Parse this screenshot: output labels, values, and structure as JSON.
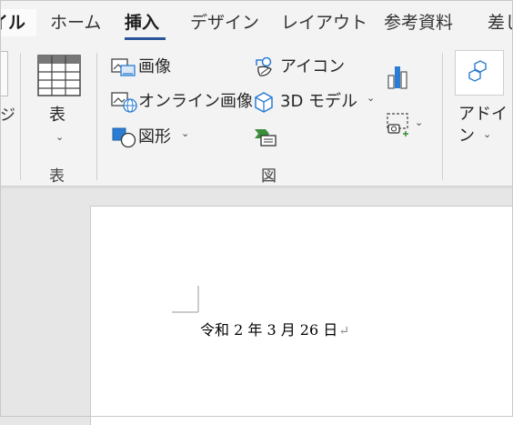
{
  "tabs": {
    "file": "イル",
    "home": "ホーム",
    "insert": "挿入",
    "design": "デザイン",
    "layout": "レイアウト",
    "references": "参考資料",
    "mailings": "差し"
  },
  "ribbon": {
    "clipped_left_text": "ジ",
    "table_group": {
      "table_button": "表",
      "label": "表"
    },
    "illustrations_group": {
      "image": "画像",
      "online_image": "オンライン画像",
      "shapes": "図形",
      "icons": "アイコン",
      "models_3d": "3D モデル",
      "label": "図"
    },
    "addins_group": {
      "addins_line1": "アドイ",
      "addins_line2": "ン"
    }
  },
  "document": {
    "text": "令和 2 年 3 月 26 日",
    "paragraph_mark": "↵"
  },
  "colors": {
    "accent": "#2b579a",
    "icon_blue": "#2b7cd3",
    "icon_green": "#3a8f3a"
  }
}
